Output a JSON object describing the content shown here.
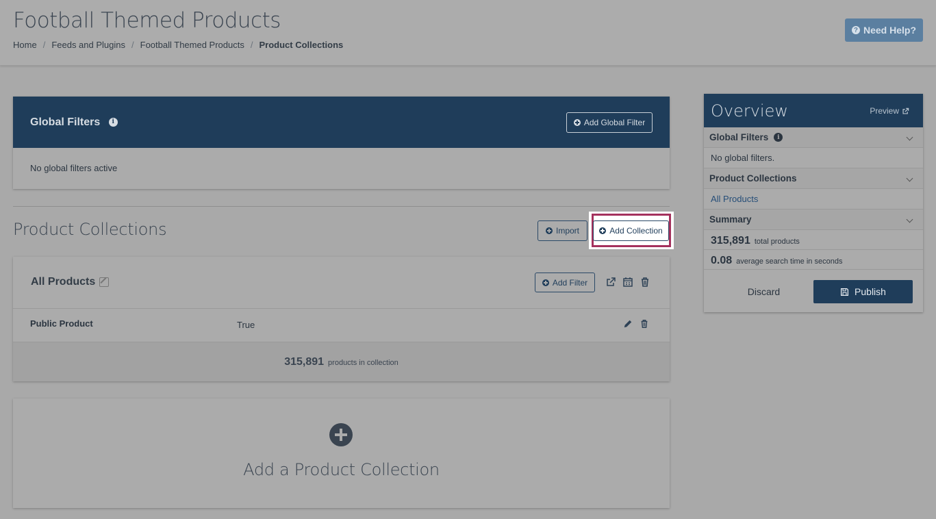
{
  "header": {
    "title": "Football Themed Products",
    "breadcrumb": [
      "Home",
      "Feeds and Plugins",
      "Football Themed Products",
      "Product Collections"
    ],
    "help_label": "Need Help?"
  },
  "global_filters": {
    "title": "Global Filters",
    "add_label": "Add Global Filter",
    "empty_text": "No global filters active"
  },
  "collections": {
    "title": "Product Collections",
    "import_label": "Import",
    "add_label": "Add Collection",
    "card": {
      "name": "All Products",
      "add_filter_label": "Add Filter",
      "rows": [
        {
          "field": "Public Product",
          "value": "True"
        }
      ],
      "count": "315,891",
      "count_label": "products in collection"
    },
    "add_card_label": "Add a Product Collection"
  },
  "overview": {
    "title": "Overview",
    "preview_label": "Preview",
    "sections": {
      "global_filters": {
        "title": "Global Filters",
        "text": "No global filters."
      },
      "product_collections": {
        "title": "Product Collections",
        "item": "All Products"
      },
      "summary": {
        "title": "Summary",
        "total": "315,891",
        "total_label": "total products",
        "avg": "0.08",
        "avg_label": "average search time in seconds"
      }
    },
    "discard_label": "Discard",
    "publish_label": "Publish"
  },
  "colors": {
    "navy": "#1f3d5a",
    "help_button": "#5b7fa0",
    "highlight_border": "#a4315d"
  }
}
